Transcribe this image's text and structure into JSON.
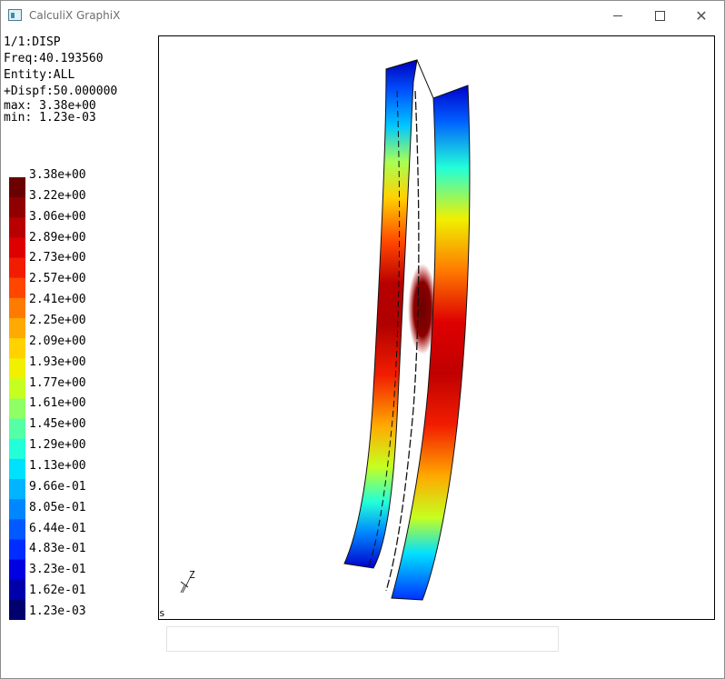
{
  "window": {
    "title": "CalculiX GraphiX",
    "close_glyph": "✕"
  },
  "info": {
    "dataset": "1/1:DISP",
    "freq": "Freq:40.193560",
    "entity": "Entity:ALL",
    "dispf": "+Dispf:50.000000",
    "max": "max: 3.38e+00",
    "min": "min: 1.23e-03"
  },
  "legend": {
    "labels": [
      "3.38e+00",
      "3.22e+00",
      "3.06e+00",
      "2.89e+00",
      "2.73e+00",
      "2.57e+00",
      "2.41e+00",
      "2.25e+00",
      "2.09e+00",
      "1.93e+00",
      "1.77e+00",
      "1.61e+00",
      "1.45e+00",
      "1.29e+00",
      "1.13e+00",
      "9.66e-01",
      "8.05e-01",
      "6.44e-01",
      "4.83e-01",
      "3.23e-01",
      "1.62e-01",
      "1.23e-03"
    ],
    "colors": [
      "#6b0000",
      "#910000",
      "#b80000",
      "#de0000",
      "#f21d00",
      "#ff4500",
      "#ff7a00",
      "#ffaa00",
      "#ffd200",
      "#f0f000",
      "#c6ff1f",
      "#8fff66",
      "#55ffa6",
      "#22ffd9",
      "#00e0ff",
      "#00b4ff",
      "#0087ff",
      "#005aff",
      "#002dff",
      "#0000e0",
      "#0000aa",
      "#00006e"
    ]
  },
  "viewport": {
    "axis_label": "Z",
    "status_char": "s"
  },
  "command_input": {
    "value": ""
  }
}
